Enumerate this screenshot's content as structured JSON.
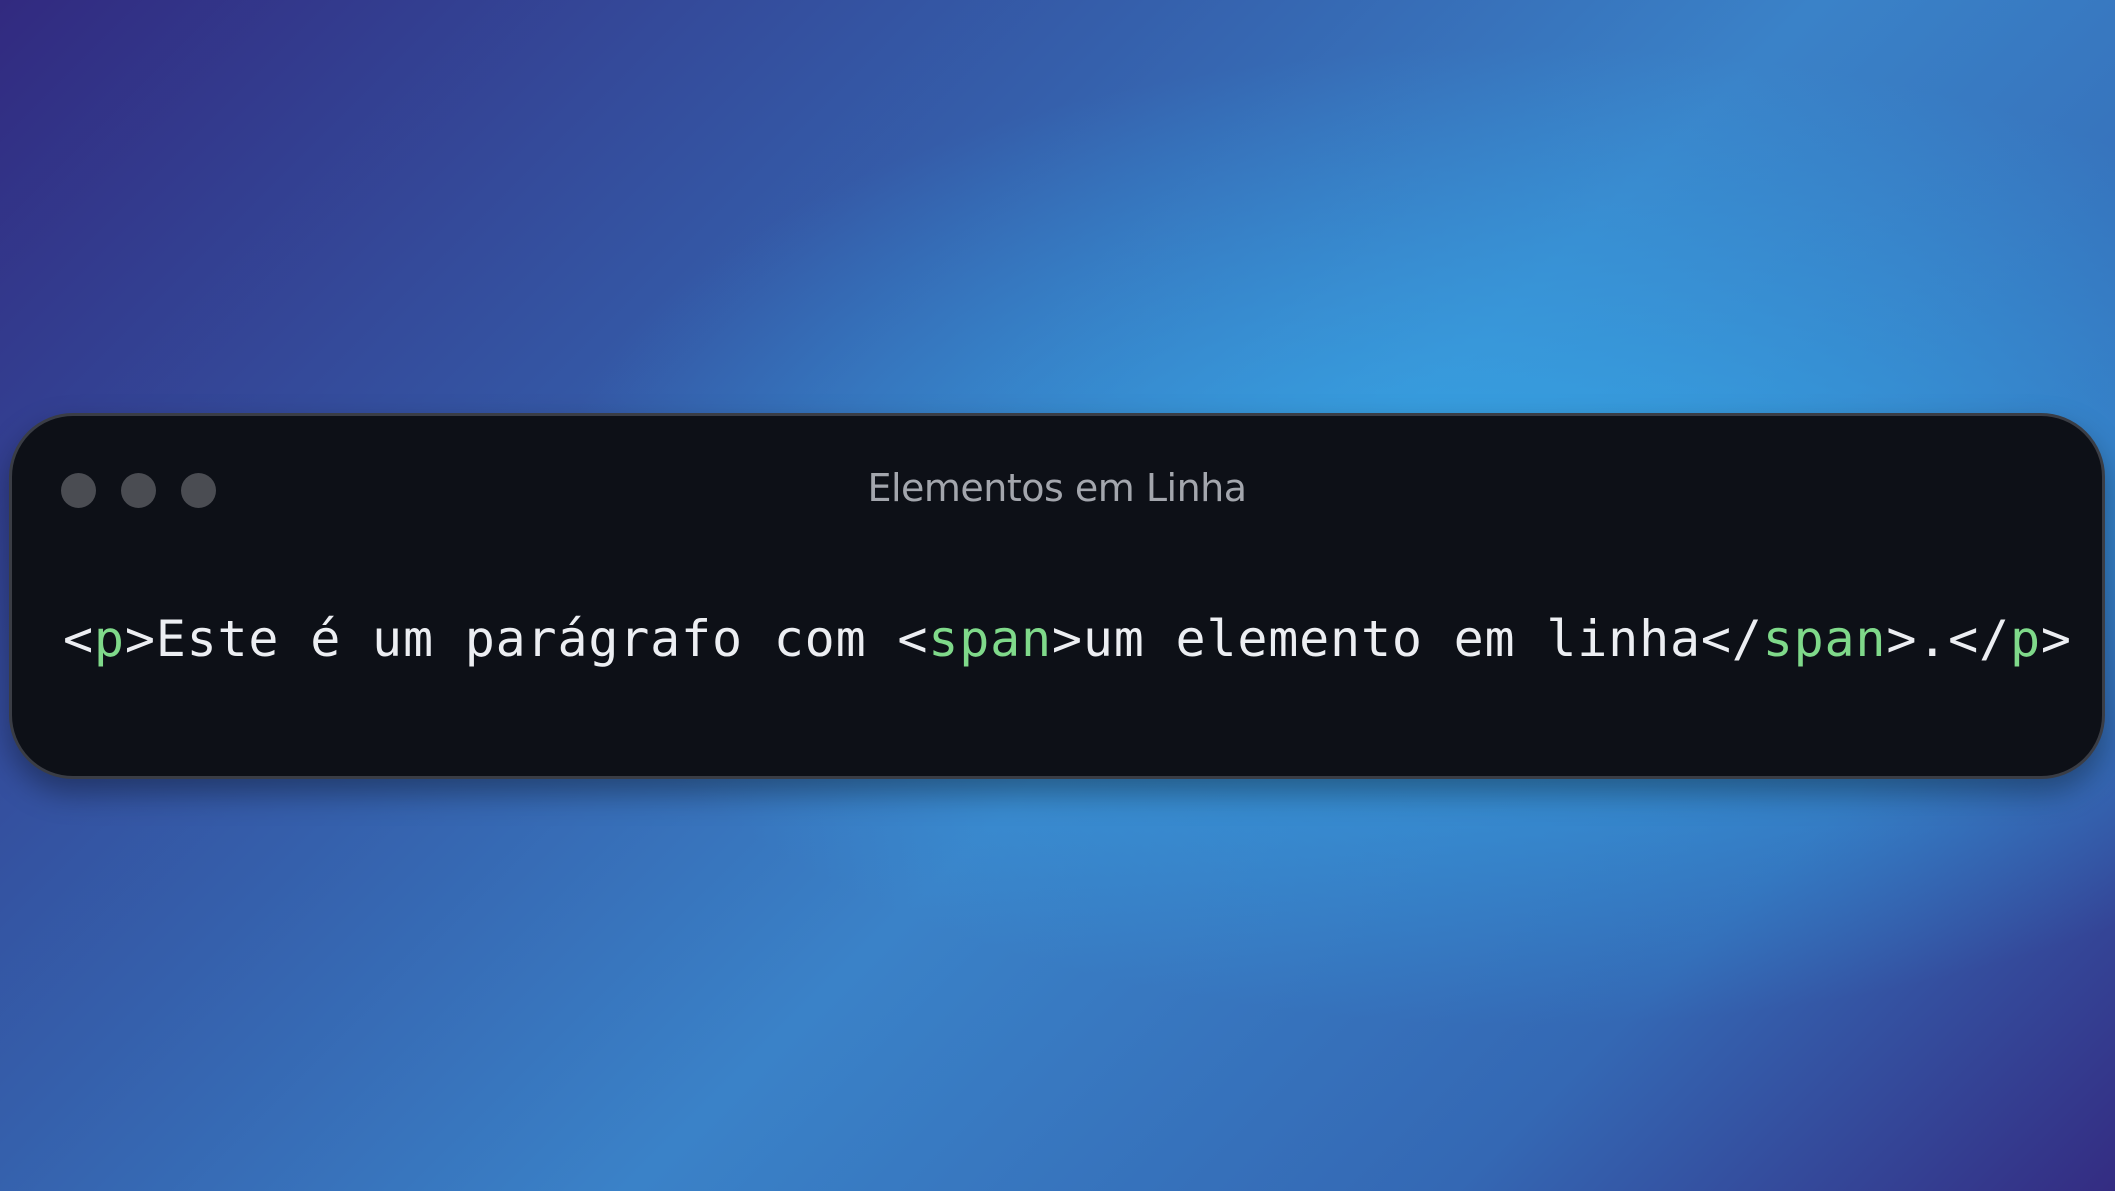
{
  "window": {
    "title": "Elementos em Linha"
  },
  "code": {
    "open_p_lt": "<",
    "open_p_name": "p",
    "open_p_gt": ">",
    "text_before": "Este é um parágrafo com ",
    "open_span_lt": "<",
    "open_span_name": "span",
    "open_span_gt": ">",
    "span_text": "um elemento em linha",
    "close_span_lt": "</",
    "close_span_name": "span",
    "close_span_gt": ">",
    "text_after": ".",
    "close_p_lt": "</",
    "close_p_name": "p",
    "close_p_gt": ">"
  },
  "colors": {
    "tag_name": "#7fd98a",
    "code_text": "#eceef2",
    "window_bg": "#0d1017",
    "title_text": "#a3a6ad",
    "traffic_dot": "#4a4c52"
  }
}
